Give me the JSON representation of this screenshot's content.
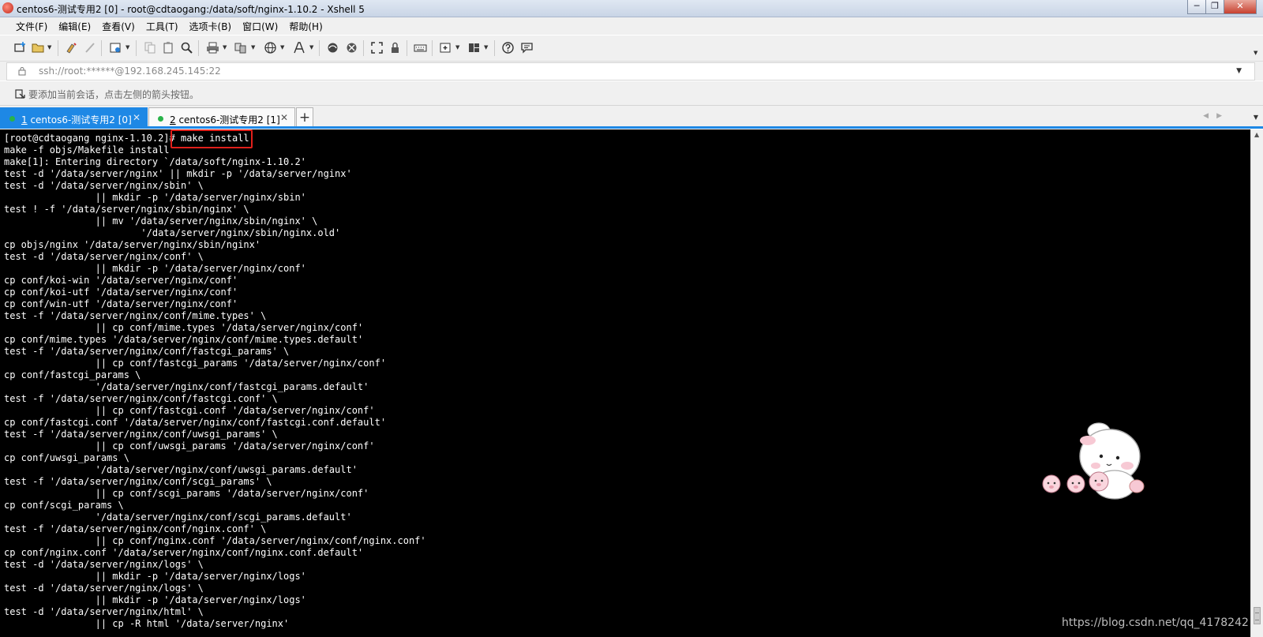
{
  "window": {
    "title": "centos6-测试专用2 [0] - root@cdtaogang:/data/soft/nginx-1.10.2 - Xshell 5",
    "minimize_glyph": "─",
    "restore_glyph": "❐",
    "close_glyph": "✕"
  },
  "menu": [
    "文件(F)",
    "编辑(E)",
    "查看(V)",
    "工具(T)",
    "选项卡(B)",
    "窗口(W)",
    "帮助(H)"
  ],
  "toolbar": {
    "icons": [
      "new-session-icon",
      "open-folder-icon",
      "reconnect-icon",
      "disconnect-icon",
      "properties-icon",
      "copy-icon",
      "paste-icon",
      "find-icon",
      "print-icon",
      "transfer-icon",
      "web-icon",
      "font-icon",
      "xftp-icon",
      "xmanager-icon",
      "fullscreen-icon",
      "lock-icon",
      "keyboard-icon",
      "compose-icon",
      "layout-icon",
      "help-icon",
      "chat-icon"
    ]
  },
  "address": {
    "value": "ssh://root:******@192.168.245.145:22"
  },
  "hint": {
    "text": "要添加当前会话，点击左侧的箭头按钮。"
  },
  "tabs": [
    {
      "num": "1",
      "label": " centos6-测试专用2 [0]",
      "active": true
    },
    {
      "num": "2",
      "label": " centos6-测试专用2 [1]",
      "active": false
    }
  ],
  "terminal": {
    "lines": [
      "[root@cdtaogang nginx-1.10.2]# make install",
      "make -f objs/Makefile install",
      "make[1]: Entering directory `/data/soft/nginx-1.10.2'",
      "test -d '/data/server/nginx' || mkdir -p '/data/server/nginx'",
      "test -d '/data/server/nginx/sbin' \\",
      "                || mkdir -p '/data/server/nginx/sbin'",
      "test ! -f '/data/server/nginx/sbin/nginx' \\",
      "                || mv '/data/server/nginx/sbin/nginx' \\",
      "                        '/data/server/nginx/sbin/nginx.old'",
      "cp objs/nginx '/data/server/nginx/sbin/nginx'",
      "test -d '/data/server/nginx/conf' \\",
      "                || mkdir -p '/data/server/nginx/conf'",
      "cp conf/koi-win '/data/server/nginx/conf'",
      "cp conf/koi-utf '/data/server/nginx/conf'",
      "cp conf/win-utf '/data/server/nginx/conf'",
      "test -f '/data/server/nginx/conf/mime.types' \\",
      "                || cp conf/mime.types '/data/server/nginx/conf'",
      "cp conf/mime.types '/data/server/nginx/conf/mime.types.default'",
      "test -f '/data/server/nginx/conf/fastcgi_params' \\",
      "                || cp conf/fastcgi_params '/data/server/nginx/conf'",
      "cp conf/fastcgi_params \\",
      "                '/data/server/nginx/conf/fastcgi_params.default'",
      "test -f '/data/server/nginx/conf/fastcgi.conf' \\",
      "                || cp conf/fastcgi.conf '/data/server/nginx/conf'",
      "cp conf/fastcgi.conf '/data/server/nginx/conf/fastcgi.conf.default'",
      "test -f '/data/server/nginx/conf/uwsgi_params' \\",
      "                || cp conf/uwsgi_params '/data/server/nginx/conf'",
      "cp conf/uwsgi_params \\",
      "                '/data/server/nginx/conf/uwsgi_params.default'",
      "test -f '/data/server/nginx/conf/scgi_params' \\",
      "                || cp conf/scgi_params '/data/server/nginx/conf'",
      "cp conf/scgi_params \\",
      "                '/data/server/nginx/conf/scgi_params.default'",
      "test -f '/data/server/nginx/conf/nginx.conf' \\",
      "                || cp conf/nginx.conf '/data/server/nginx/conf/nginx.conf'",
      "cp conf/nginx.conf '/data/server/nginx/conf/nginx.conf.default'",
      "test -d '/data/server/nginx/logs' \\",
      "                || mkdir -p '/data/server/nginx/logs'",
      "test -d '/data/server/nginx/logs' \\",
      "                || mkdir -p '/data/server/nginx/logs'",
      "test -d '/data/server/nginx/html' \\",
      "                || cp -R html '/data/server/nginx'"
    ]
  },
  "watermark": "https://blog.csdn.net/qq_4178242",
  "colors": {
    "accent": "#1e88e5",
    "terminal_bg": "#000000",
    "terminal_fg": "#ffffff",
    "highlight": "#e0201b"
  }
}
